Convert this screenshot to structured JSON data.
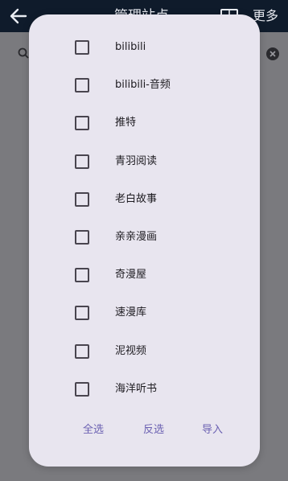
{
  "appbar": {
    "title": "管理站点",
    "more_label": "更多",
    "back_icon": "arrow-left-icon",
    "window_icon": "window-icon"
  },
  "search": {
    "search_icon": "search-icon",
    "clear_icon": "clear-icon"
  },
  "dialog": {
    "items": [
      {
        "label": "bilibili",
        "checked": false
      },
      {
        "label": "bilibili-音频",
        "checked": false
      },
      {
        "label": "推特",
        "checked": false
      },
      {
        "label": "青羽阅读",
        "checked": false
      },
      {
        "label": "老白故事",
        "checked": false
      },
      {
        "label": "亲亲漫画",
        "checked": false
      },
      {
        "label": "奇漫屋",
        "checked": false
      },
      {
        "label": "速漫库",
        "checked": false
      },
      {
        "label": "泥视频",
        "checked": false
      },
      {
        "label": "海洋听书",
        "checked": false
      }
    ],
    "actions": {
      "select_all": "全选",
      "invert": "反选",
      "import": "导入"
    }
  },
  "colors": {
    "dialog_bg": "#e8e5ef",
    "accent": "#6b61b2",
    "appbar_bg": "#0f1b2b",
    "scrim": "#7a7a7e"
  }
}
